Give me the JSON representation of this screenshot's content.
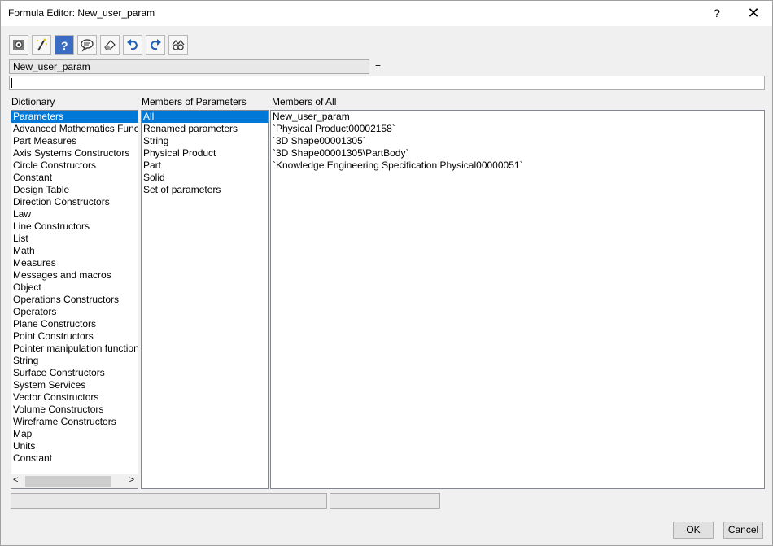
{
  "window": {
    "title": "Formula Editor: New_user_param",
    "help_label": "?",
    "close_label": "✕"
  },
  "toolbar": {
    "icons": [
      "settings-gear-icon",
      "magic-wand-icon",
      "help-icon",
      "speech-bubble-icon",
      "eraser-icon",
      "undo-icon",
      "redo-icon",
      "binoculars-icon"
    ]
  },
  "formula": {
    "parameter_name": "New_user_param",
    "equals": "=",
    "value": ""
  },
  "dictionary": {
    "label": "Dictionary",
    "items": [
      "Parameters",
      "Advanced Mathematics Functions",
      "Part Measures",
      "Axis Systems Constructors",
      "Circle Constructors",
      "Constant",
      "Design Table",
      "Direction Constructors",
      "Law",
      "Line Constructors",
      "List",
      "Math",
      "Measures",
      "Messages and macros",
      "Object",
      "Operations Constructors",
      "Operators",
      "Plane Constructors",
      "Point Constructors",
      "Pointer manipulation functions",
      "String",
      "Surface Constructors",
      "System Services",
      "Vector Constructors",
      "Volume Constructors",
      "Wireframe Constructors",
      "Map",
      "Units",
      "Constant"
    ],
    "selected_index": 0
  },
  "members_of_parameters": {
    "label": "Members of Parameters",
    "items": [
      "All",
      "Renamed parameters",
      "String",
      "Physical Product",
      "Part",
      "Solid",
      "Set of parameters"
    ],
    "selected_index": 0
  },
  "members_of_all": {
    "label": "Members of All",
    "items": [
      "New_user_param",
      "`Physical Product00002158`",
      "`3D Shape00001305`",
      "`3D Shape00001305\\PartBody`",
      "`Knowledge Engineering Specification Physical00000051`"
    ]
  },
  "scrollbar": {
    "left_arrow": "<",
    "right_arrow": ">"
  },
  "buttons": {
    "ok": "OK",
    "cancel": "Cancel"
  }
}
